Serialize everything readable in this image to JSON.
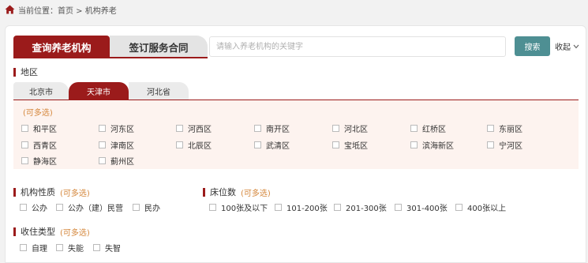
{
  "breadcrumb": {
    "text": "当前位置：首页 > 机构养老"
  },
  "tabs": [
    "查询养老机构",
    "签订服务合同"
  ],
  "search": {
    "placeholder": "请输入养老机构的关键字",
    "button": "搜索",
    "collapse": "收起"
  },
  "region": {
    "title": "地区",
    "provinces": [
      "北京市",
      "天津市",
      "河北省"
    ],
    "selected_province": "天津市",
    "hint": "(可多选)",
    "districts": [
      "和平区",
      "河东区",
      "河西区",
      "南开区",
      "河北区",
      "红桥区",
      "东丽区",
      "西青区",
      "津南区",
      "北辰区",
      "武清区",
      "宝坻区",
      "滨海新区",
      "宁河区",
      "静海区",
      "蓟州区"
    ]
  },
  "nature": {
    "title": "机构性质",
    "hint": "(可多选)",
    "options": [
      "公办",
      "公办（建）民营",
      "民办"
    ]
  },
  "beds": {
    "title": "床位数",
    "hint": "(可多选)",
    "options": [
      "100张及以下",
      "101-200张",
      "201-300张",
      "301-400张",
      "400张以上"
    ]
  },
  "intake": {
    "title": "收住类型",
    "hint": "(可多选)",
    "options": [
      "自理",
      "失能",
      "失智"
    ]
  },
  "colors": {
    "accent": "#9b1b1b",
    "search_button": "#4e8f93",
    "hint": "#d4863a"
  }
}
